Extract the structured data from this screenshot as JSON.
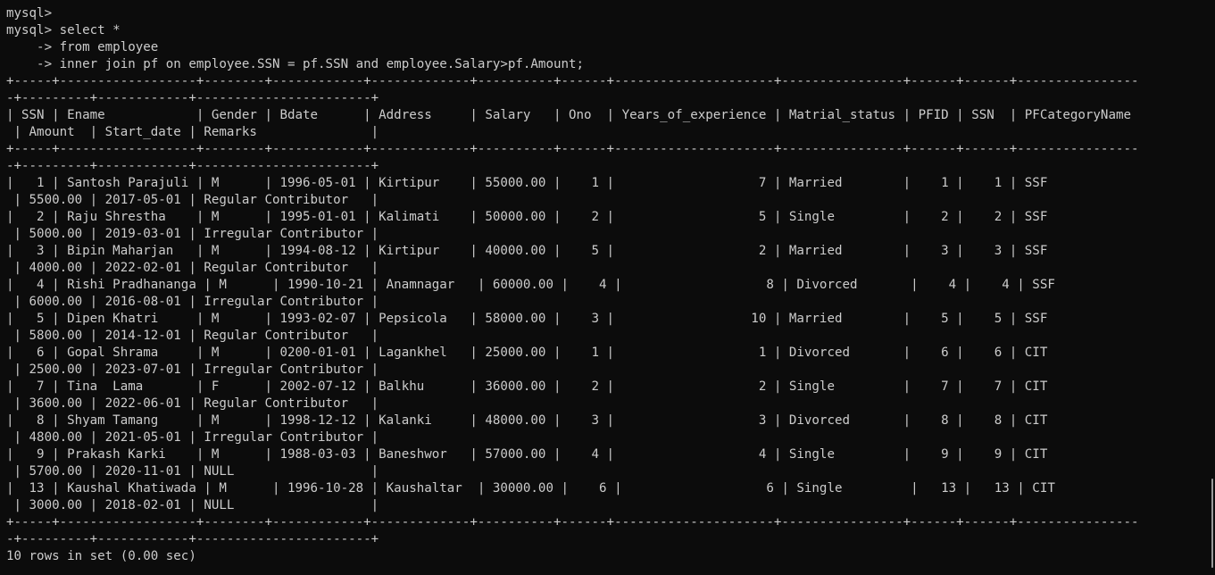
{
  "terminal": {
    "lines": [
      "mysql>",
      "mysql> select *",
      "    -> from employee",
      "    -> inner join pf on employee.SSN = pf.SSN and employee.Salary>pf.Amount;",
      "+-----+------------------+--------+------------+-------------+----------+------+---------------------+----------------+------+------+----------------",
      "-+---------+------------+-----------------------+",
      "| SSN | Ename            | Gender | Bdate      | Address     | Salary   | Ono  | Years_of_experience | Matrial_status | PFID | SSN  | PFCategoryName",
      " | Amount  | Start_date | Remarks               |",
      "+-----+------------------+--------+------------+-------------+----------+------+---------------------+----------------+------+------+----------------",
      "-+---------+------------+-----------------------+",
      "|   1 | Santosh Parajuli | M      | 1996-05-01 | Kirtipur    | 55000.00 |    1 |                   7 | Married        |    1 |    1 | SSF",
      " | 5500.00 | 2017-05-01 | Regular Contributor   |",
      "|   2 | Raju Shrestha    | M      | 1995-01-01 | Kalimati    | 50000.00 |    2 |                   5 | Single         |    2 |    2 | SSF",
      " | 5000.00 | 2019-03-01 | Irregular Contributor |",
      "|   3 | Bipin Maharjan   | M      | 1994-08-12 | Kirtipur    | 40000.00 |    5 |                   2 | Married        |    3 |    3 | SSF",
      " | 4000.00 | 2022-02-01 | Regular Contributor   |",
      "|   4 | Rishi Pradhananga | M      | 1990-10-21 | Anamnagar   | 60000.00 |    4 |                   8 | Divorced       |    4 |    4 | SSF",
      " | 6000.00 | 2016-08-01 | Irregular Contributor |",
      "|   5 | Dipen Khatri     | M      | 1993-02-07 | Pepsicola   | 58000.00 |    3 |                  10 | Married        |    5 |    5 | SSF",
      " | 5800.00 | 2014-12-01 | Regular Contributor   |",
      "|   6 | Gopal Shrama     | M      | 0200-01-01 | Lagankhel   | 25000.00 |    1 |                   1 | Divorced       |    6 |    6 | CIT",
      " | 2500.00 | 2023-07-01 | Irregular Contributor |",
      "|   7 | Tina  Lama       | F      | 2002-07-12 | Balkhu      | 36000.00 |    2 |                   2 | Single         |    7 |    7 | CIT",
      " | 3600.00 | 2022-06-01 | Regular Contributor   |",
      "|   8 | Shyam Tamang     | M      | 1998-12-12 | Kalanki     | 48000.00 |    3 |                   3 | Divorced       |    8 |    8 | CIT",
      " | 4800.00 | 2021-05-01 | Irregular Contributor |",
      "|   9 | Prakash Karki    | M      | 1988-03-03 | Baneshwor   | 57000.00 |    4 |                   4 | Single         |    9 |    9 | CIT",
      " | 5700.00 | 2020-11-01 | NULL                  |",
      "|  13 | Kaushal Khatiwada | M      | 1996-10-28 | Kaushaltar  | 30000.00 |    6 |                   6 | Single         |   13 |   13 | CIT",
      " | 3000.00 | 2018-02-01 | NULL                  |",
      "+-----+------------------+--------+------------+-------------+----------+------+---------------------+----------------+------+------+----------------",
      "-+---------+------------+-----------------------+",
      "10 rows in set (0.00 sec)"
    ]
  },
  "colors": {
    "background": "#0c0c0c",
    "text": "#cccccc",
    "scrollbar": "#9a9a9a"
  }
}
